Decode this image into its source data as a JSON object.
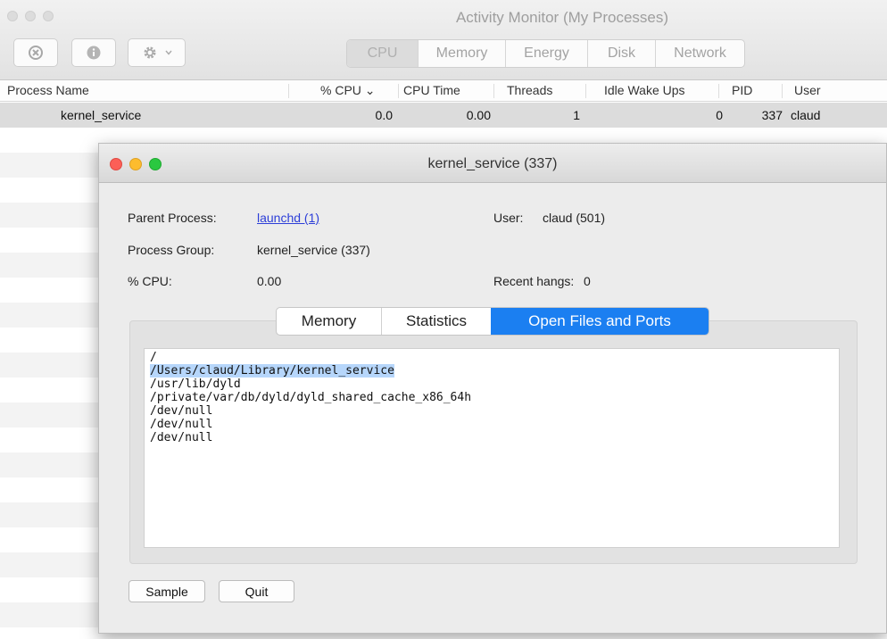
{
  "window": {
    "title": "Activity Monitor (My Processes)"
  },
  "toolbar": {
    "buttons": [
      {
        "icon": "stop-process-icon"
      },
      {
        "icon": "info-icon"
      },
      {
        "icon": "gear-icon"
      }
    ],
    "tabs": [
      "CPU",
      "Memory",
      "Energy",
      "Disk",
      "Network"
    ],
    "active_tab": "CPU"
  },
  "table": {
    "columns": [
      "Process Name",
      "% CPU",
      "CPU Time",
      "Threads",
      "Idle Wake Ups",
      "PID",
      "User"
    ],
    "sort_indicator": "⌄",
    "rows": [
      {
        "name": "kernel_service",
        "cpu": "0.0",
        "cpu_time": "0.00",
        "threads": "1",
        "idle_wake_ups": "0",
        "pid": "337",
        "user": "claud"
      }
    ]
  },
  "dialog": {
    "title": "kernel_service (337)",
    "parent_process_label": "Parent Process:",
    "parent_process_value": "launchd (1)",
    "user_label": "User:",
    "user_value": "claud (501)",
    "process_group_label": "Process Group:",
    "process_group_value": "kernel_service (337)",
    "cpu_label": "% CPU:",
    "cpu_value": "0.00",
    "recent_hangs_label": "Recent hangs:",
    "recent_hangs_value": "0",
    "tabs": [
      "Memory",
      "Statistics",
      "Open Files and Ports"
    ],
    "active_tab": "Open Files and Ports",
    "open_files": [
      "/",
      "/Users/claud/Library/kernel_service",
      "/usr/lib/dyld",
      "/private/var/db/dyld/dyld_shared_cache_x86_64h",
      "/dev/null",
      "/dev/null",
      "/dev/null"
    ],
    "selected_file": "/Users/claud/Library/kernel_service",
    "sample_button": "Sample",
    "quit_button": "Quit"
  },
  "colors": {
    "accent": "#1b7ff1",
    "selection": "#b6d6fb",
    "close": "#fc5f57",
    "minimize": "#fdbc2e",
    "zoom": "#2ac840",
    "link": "#2c3ed8"
  }
}
